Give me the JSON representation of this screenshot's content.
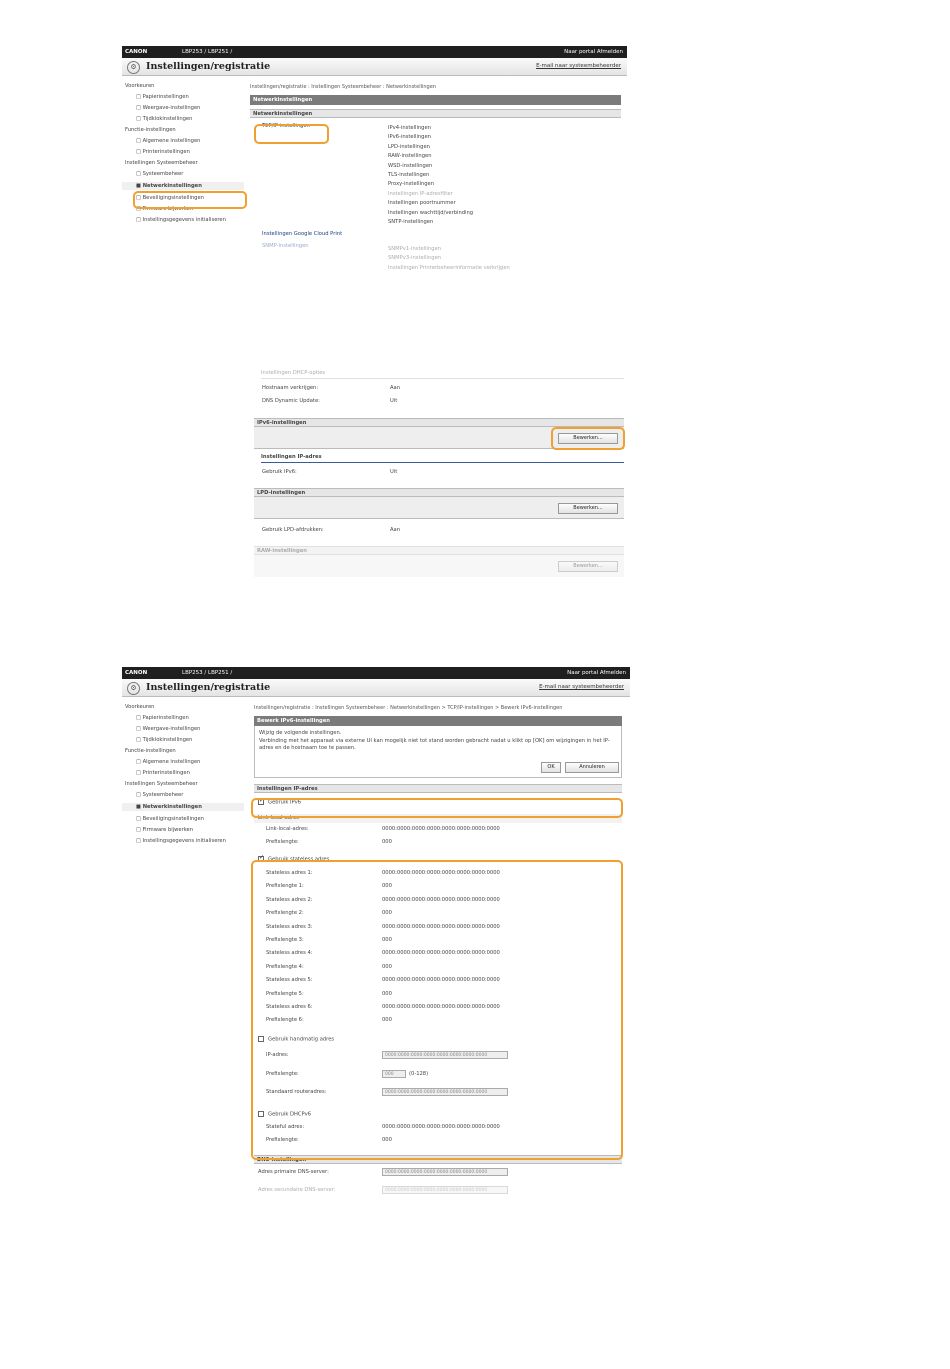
{
  "header": {
    "brand": "CANON",
    "model_top": "LBP253 / LBP251 /",
    "model_bottom": "LBP253 / LBP251 /",
    "links": "Naar portal Afmelden",
    "title": "Instellingen/registratie",
    "mail_link": "E-mail naar systeembeheerder"
  },
  "sidebar": {
    "sec_prefs": "Voorkeuren",
    "paper": "Papierinstellingen",
    "display": "Weergave-instellingen",
    "timer": "Tijdklokinstellingen",
    "func_sec": "Functie-instellingen",
    "general": "Algemene instellingen",
    "printer": "Printerinstellingen",
    "sys_sec": "Instellingen Systeembeheer",
    "sysadmin": "Systeembeheer",
    "network": "Netwerkinstellingen",
    "security": "Beveiligingsinstellingen",
    "firmware": "Firmware bijwerken",
    "reset": "Instellingsgegevens initialiseren"
  },
  "panel1": {
    "breadcrumb": "Instellingen/registratie : Instellingen Systeembeheer : Netwerkinstellingen",
    "header": "Netwerkinstellingen",
    "sub": "Netwerkinstellingen",
    "tcpip_link": "TCP/IP-instellingen",
    "items": [
      "IPv4-instellingen",
      "IPv6-instellingen",
      "LPD-instellingen",
      "RAW-instellingen",
      "WSD-instellingen",
      "TLS-instellingen",
      "Proxy-instellingen",
      "Instellingen IP-adresfilter",
      "Instellingen poortnummer",
      "Instellingen wachttijd/verbinding",
      "SNTP-instellingen"
    ],
    "google_link": "Instellingen Google Cloud Print",
    "snmp_link": "SNMP-instellingen",
    "snmp_items": [
      "SNMPv1-instellingen",
      "SNMPv3-instellingen",
      "Instellingen Printerbeheerinformatie verkrijgen"
    ]
  },
  "panel2": {
    "dhcp_sub": "Instellingen DHCP-opties",
    "rows_top": [
      {
        "label": "Hostnaam verkrijgen:",
        "value": "Aan"
      },
      {
        "label": "DNS Dynamic Update:",
        "value": "Uit"
      }
    ],
    "ipv6_header": "IPv6-instellingen",
    "edit": "Bewerken...",
    "ip_sub": "Instellingen IP-adres",
    "ipv6_use_label": "Gebruik IPv6:",
    "ipv6_use_value": "Uit",
    "lpd_header": "LPD-instellingen",
    "lpd_label": "Gebruik LPD-afdrukken:",
    "lpd_value": "Aan",
    "raw_header": "RAW-instellingen"
  },
  "panel3": {
    "breadcrumb": "Instellingen/registratie : Instellingen Systeembeheer : Netwerkinstellingen > TCP/IP-instellingen > Bewerk IPv6-instellingen",
    "header": "Bewerk IPv6-instellingen",
    "intro1": "Wijzig de volgende instellingen.",
    "intro2": "Verbinding met het apparaat via externe UI kan mogelijk niet tot stand worden gebracht nadat u klikt op [OK] om wijzigingen in het IP-adres en de hostnaam toe te passen.",
    "ok": "OK",
    "cancel": "Annuleren",
    "ip_sub": "Instellingen IP-adres",
    "use_ipv6": "Gebruik IPv6",
    "link_local_sec": "Link-local-adres",
    "link_local_label": "Link-local-adres:",
    "link_local_value": "0000:0000:0000:0000:0000:0000:0000:0000",
    "prefix_label": "Prefixlengte:",
    "prefix_value": "000",
    "use_stateless": "Gebruik stateless adres",
    "stateless": [
      {
        "addr_label": "Stateless adres 1:",
        "addr": "0000:0000:0000:0000:0000:0000:0000:0000",
        "pre_label": "Prefixlengte 1:",
        "pre": "000"
      },
      {
        "addr_label": "Stateless adres 2:",
        "addr": "0000:0000:0000:0000:0000:0000:0000:0000",
        "pre_label": "Prefixlengte 2:",
        "pre": "000"
      },
      {
        "addr_label": "Stateless adres 3:",
        "addr": "0000:0000:0000:0000:0000:0000:0000:0000",
        "pre_label": "Prefixlengte 3:",
        "pre": "000"
      },
      {
        "addr_label": "Stateless adres 4:",
        "addr": "0000:0000:0000:0000:0000:0000:0000:0000",
        "pre_label": "Prefixlengte 4:",
        "pre": "000"
      },
      {
        "addr_label": "Stateless adres 5:",
        "addr": "0000:0000:0000:0000:0000:0000:0000:0000",
        "pre_label": "Prefixlengte 5:",
        "pre": "000"
      },
      {
        "addr_label": "Stateless adres 6:",
        "addr": "0000:0000:0000:0000:0000:0000:0000:0000",
        "pre_label": "Prefixlengte 6:",
        "pre": "000"
      }
    ],
    "use_manual": "Gebruik handmatig adres",
    "ip_label": "IP-adres:",
    "ip_field": "0000:0000:0000:0000:0000:0000:0000:0000",
    "manual_prefix_label": "Prefixlengte:",
    "manual_prefix_field": "000",
    "manual_prefix_range": "(0-128)",
    "router_label": "Standaard routeradres:",
    "router_field": "0000:0000:0000:0000:0000:0000:0000:0000",
    "use_dhcp": "Gebruik DHCPv6",
    "stateful_label": "Stateful adres:",
    "stateful_value": "0000:0000:0000:0000:0000:0000:0000:0000",
    "dhcp_prefix_label": "Prefixlengte:",
    "dhcp_prefix_value": "000",
    "dns_sub": "DNS-instellingen",
    "dns_primary_label": "Adres primaire DNS-server:",
    "dns_primary_field": "0000:0000:0000:0000:0000:0000:0000:0000",
    "dns_secondary_label": "Adres secundaire DNS-server:",
    "dns_secondary_field": "0000:0000:0000:0000:0000:0000:0000:0000"
  }
}
